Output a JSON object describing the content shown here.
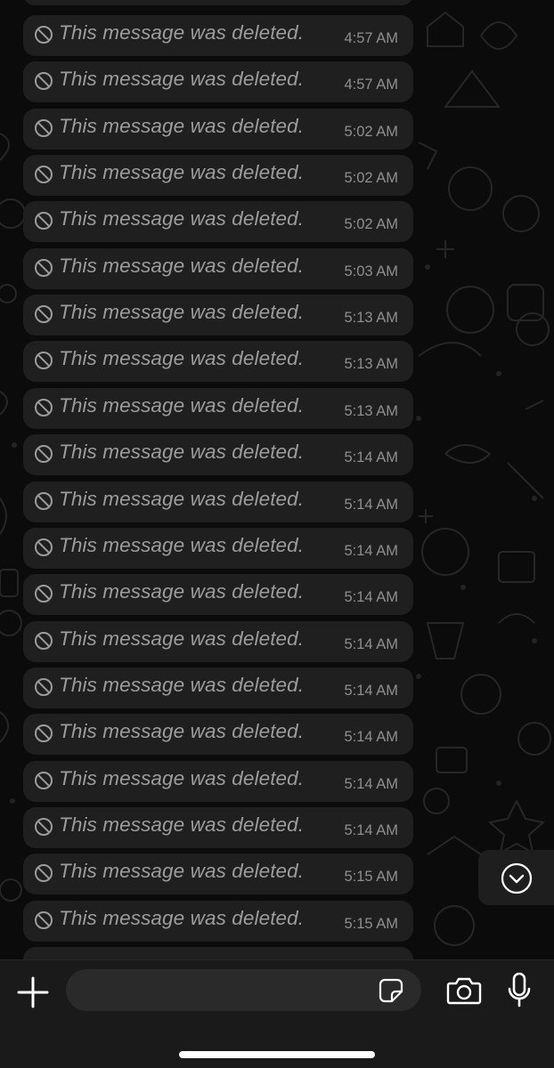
{
  "messages": [
    {
      "text": "This message was deleted.",
      "time": "4:57 AM"
    },
    {
      "text": "This message was deleted.",
      "time": "4:57 AM"
    },
    {
      "text": "This message was deleted.",
      "time": "5:02 AM"
    },
    {
      "text": "This message was deleted.",
      "time": "5:02 AM"
    },
    {
      "text": "This message was deleted.",
      "time": "5:02 AM"
    },
    {
      "text": "This message was deleted.",
      "time": "5:03 AM"
    },
    {
      "text": "This message was deleted.",
      "time": "5:13 AM"
    },
    {
      "text": "This message was deleted.",
      "time": "5:13 AM"
    },
    {
      "text": "This message was deleted.",
      "time": "5:13 AM"
    },
    {
      "text": "This message was deleted.",
      "time": "5:14 AM"
    },
    {
      "text": "This message was deleted.",
      "time": "5:14 AM"
    },
    {
      "text": "This message was deleted.",
      "time": "5:14 AM"
    },
    {
      "text": "This message was deleted.",
      "time": "5:14 AM"
    },
    {
      "text": "This message was deleted.",
      "time": "5:14 AM"
    },
    {
      "text": "This message was deleted.",
      "time": "5:14 AM"
    },
    {
      "text": "This message was deleted.",
      "time": "5:14 AM"
    },
    {
      "text": "This message was deleted.",
      "time": "5:14 AM"
    },
    {
      "text": "This message was deleted.",
      "time": "5:14 AM"
    },
    {
      "text": "This message was deleted.",
      "time": "5:15 AM"
    },
    {
      "text": "This message was deleted.",
      "time": "5:15 AM"
    }
  ],
  "composer": {
    "input_value": "",
    "input_placeholder": ""
  },
  "icons": {
    "deleted": "ban-icon",
    "scroll_down": "chevron-down-circle-icon",
    "add": "plus-icon",
    "sticker": "sticker-icon",
    "camera": "camera-icon",
    "mic": "microphone-icon"
  },
  "colors": {
    "background": "#0b0b0b",
    "bubble": "#1f1f1f",
    "message_text": "#9c9c9c",
    "time_text": "#8f8f8f",
    "composer_bar": "#1a1a1a",
    "icon": "#ffffff"
  }
}
